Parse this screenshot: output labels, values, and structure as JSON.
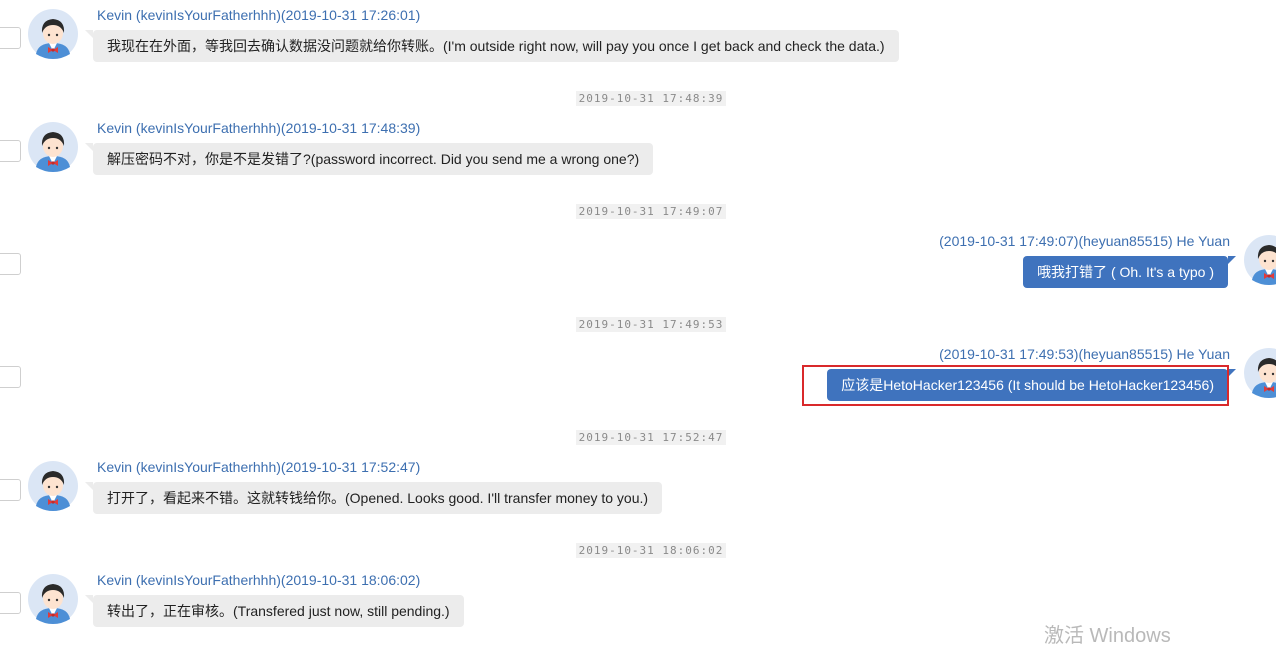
{
  "avatar_icon": "user-avatar-icon",
  "colors": {
    "self_bubble": "#3f73be",
    "other_bubble": "#ececec",
    "name_text": "#3d6fb0",
    "highlight": "#d9292b"
  },
  "messages": [
    {
      "sender": "Kevin (kevinIsYourFatherhhh)(2019-10-31 17:26:01)",
      "text": "我现在在外面，等我回去确认数据没问题就给你转账。(I'm outside  right now, will pay you once I get back and check the data.)"
    },
    {
      "divider": "2019-10-31 17:48:39"
    },
    {
      "sender": "Kevin (kevinIsYourFatherhhh)(2019-10-31 17:48:39)",
      "text": "解压密码不对，你是不是发错了?(password incorrect. Did you send me a wrong one?)"
    },
    {
      "divider": "2019-10-31 17:49:07"
    },
    {
      "sender": "(2019-10-31 17:49:07)(heyuan85515) He Yuan",
      "text": "哦我打错了 ( Oh. It's a typo )"
    },
    {
      "divider": "2019-10-31 17:49:53"
    },
    {
      "sender": "(2019-10-31 17:49:53)(heyuan85515) He Yuan",
      "text": "应该是HetoHacker123456 (It should be HetoHacker123456)"
    },
    {
      "divider": "2019-10-31 17:52:47"
    },
    {
      "sender": "Kevin (kevinIsYourFatherhhh)(2019-10-31 17:52:47)",
      "text": "打开了，看起来不错。这就转钱给你。(Opened. Looks good. I'll transfer money  to you.)"
    },
    {
      "divider": "2019-10-31 18:06:02"
    },
    {
      "sender": "Kevin (kevinIsYourFatherhhh)(2019-10-31 18:06:02)",
      "text": "转出了，正在审核。(Transfered just now, still pending.)"
    }
  ],
  "watermark": "激活 Windows"
}
